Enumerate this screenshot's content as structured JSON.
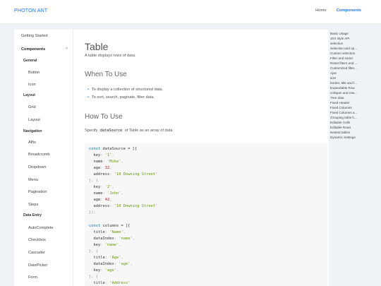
{
  "brand": "PHOTON ANT",
  "topnav": {
    "home": "Home",
    "components": "Components"
  },
  "sidebar": {
    "getting_started": "Getting Started",
    "components": "Components",
    "groups": {
      "general": "General",
      "layout": "Layout",
      "navigation": "Navigation",
      "data_entry": "Data Entry"
    },
    "items": {
      "button": "Button",
      "icon": "Icon",
      "grid": "Grid",
      "layout": "Layout",
      "affix": "Affix",
      "breadcrumb": "Breadcrumb",
      "dropdown": "Dropdown",
      "menu": "Menu",
      "pagination": "Pagination",
      "steps": "Steps",
      "autocomplete": "AutoComplete",
      "checkbox": "Checkbox",
      "cascader": "Cascader",
      "datepicker": "DatePicker",
      "form": "Form"
    }
  },
  "main": {
    "title": "Table",
    "description": "A table displays rows of data.",
    "when_heading": "When To Use",
    "bullets": [
      "To display a collection of structured data.",
      "To sort, search, paginate, filter data."
    ],
    "how_heading": "How To Use",
    "specify_pre": "Specify",
    "specify_code": "dataSource",
    "specify_post": "of Table as an array of data."
  },
  "code": {
    "l1a": "const",
    "l1b": " dataSource = [{",
    "key": "key",
    "name": "name",
    "age": "age",
    "address": "address",
    "v_key1": "'1'",
    "v_name1": "'Mike'",
    "v_age1": "32",
    "v_addr1": "'10 Downing Street'",
    "sep": "}, {",
    "v_key2": "'2'",
    "v_name2": "'John'",
    "v_age2": "42",
    "v_addr2": "'10 Downing Street'",
    "end": "}];",
    "l2a": "const",
    "l2b": " columns = [{",
    "title": "title",
    "dataIndex": "dataIndex",
    "v_title1": "'Name'",
    "v_di1": "'name'",
    "v_k1": "'name'",
    "v_title2": "'Age'",
    "v_di2": "'age'",
    "v_k2": "'age'",
    "v_title3": "'Address'"
  },
  "toc": [
    "Basic Usage",
    "JSX style API",
    "selection",
    "Selection and op...",
    "Custom selection",
    "Filter and sorter",
    "Reset filters and ...",
    "Customized filter...",
    "Ajax",
    "size",
    "border, title and f...",
    "Expandable Row",
    "colSpan and row...",
    "Tree data",
    "Fixed Header",
    "Fixed Columns",
    "Fixed Columns a...",
    "Grouping table h...",
    "Editable Cells",
    "Editable Rows",
    "Nested tables",
    "Dynamic Settings"
  ]
}
